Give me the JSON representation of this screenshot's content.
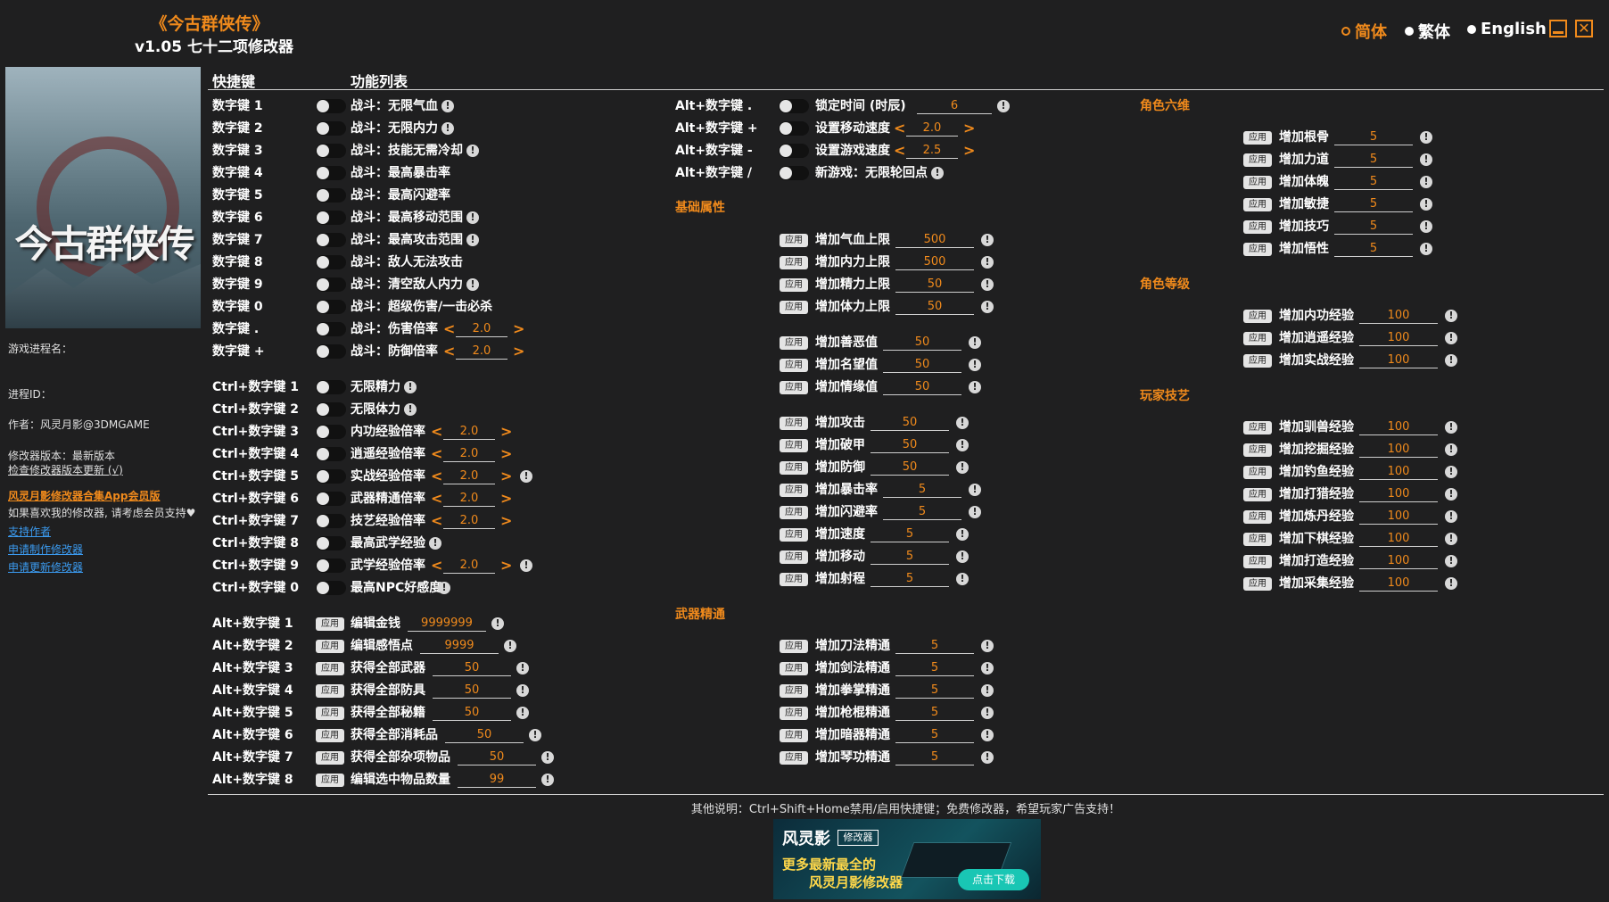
{
  "header": {
    "title": "《今古群侠传》",
    "subtitle": "v1.05 七十二项修改器"
  },
  "languages": [
    {
      "label": "简体",
      "selected": true
    },
    {
      "label": "繁体",
      "selected": false
    },
    {
      "label": "English",
      "selected": false
    }
  ],
  "window": {
    "minimize_icon": "minimize-icon",
    "close_icon": "close-icon",
    "close_glyph": "✕"
  },
  "cover": {
    "logo_text": "今古群侠传"
  },
  "sidebar": {
    "process_name_label": "游戏进程名：",
    "process_id_label": "进程ID：",
    "author": "作者：风灵月影@3DMGAME",
    "version": "修改器版本：最新版本",
    "check_update": "检查修改器版本更新 (√)",
    "app_promo": "风灵月影修改器合集App会员版",
    "support_note": "如果喜欢我的修改器, 请考虑会员支持♥",
    "links": [
      "支持作者",
      "申请制作修改器",
      "申请更新修改器"
    ]
  },
  "columns": {
    "hotkey": "快捷键",
    "features": "功能列表"
  },
  "info_glyph": "!",
  "apply_label": "应用",
  "arrows": {
    "left": "<",
    "right": ">"
  },
  "col1": {
    "group1": [
      {
        "key": "数字键 1",
        "label": "战斗：无限气血",
        "info": true
      },
      {
        "key": "数字键 2",
        "label": "战斗：无限内力",
        "info": true
      },
      {
        "key": "数字键 3",
        "label": "战斗：技能无需冷却",
        "info": true
      },
      {
        "key": "数字键 4",
        "label": "战斗：最高暴击率",
        "info": false
      },
      {
        "key": "数字键 5",
        "label": "战斗：最高闪避率",
        "info": false
      },
      {
        "key": "数字键 6",
        "label": "战斗：最高移动范围",
        "info": true
      },
      {
        "key": "数字键 7",
        "label": "战斗：最高攻击范围",
        "info": true
      },
      {
        "key": "数字键 8",
        "label": "战斗：敌人无法攻击",
        "info": false
      },
      {
        "key": "数字键 9",
        "label": "战斗：清空敌人内力",
        "info": true
      },
      {
        "key": "数字键 0",
        "label": "战斗：超级伤害/一击必杀",
        "info": false
      },
      {
        "key": "数字键 .",
        "label": "战斗：伤害倍率",
        "value": "2.0",
        "info": false
      },
      {
        "key": "数字键 +",
        "label": "战斗：防御倍率",
        "value": "2.0",
        "info": false
      }
    ],
    "group2": [
      {
        "key": "Ctrl+数字键 1",
        "label": "无限精力",
        "info": true
      },
      {
        "key": "Ctrl+数字键 2",
        "label": "无限体力",
        "info": true
      },
      {
        "key": "Ctrl+数字键 3",
        "label": "内功经验倍率",
        "value": "2.0",
        "info": false
      },
      {
        "key": "Ctrl+数字键 4",
        "label": "逍遥经验倍率",
        "value": "2.0",
        "info": false
      },
      {
        "key": "Ctrl+数字键 5",
        "label": "实战经验倍率",
        "value": "2.0",
        "info": true
      },
      {
        "key": "Ctrl+数字键 6",
        "label": "武器精通倍率",
        "value": "2.0",
        "info": false
      },
      {
        "key": "Ctrl+数字键 7",
        "label": "技艺经验倍率",
        "value": "2.0",
        "info": false
      },
      {
        "key": "Ctrl+数字键 8",
        "label": "最高武学经验",
        "info": true
      },
      {
        "key": "Ctrl+数字键 9",
        "label": "武学经验倍率",
        "value": "2.0",
        "info": true
      },
      {
        "key": "Ctrl+数字键 0",
        "label": "最高NPC好感度",
        "info": true
      }
    ],
    "group3": [
      {
        "key": "Alt+数字键 1",
        "label": "编辑金钱",
        "value": "9999999"
      },
      {
        "key": "Alt+数字键 2",
        "label": "编辑感悟点",
        "value": "9999"
      },
      {
        "key": "Alt+数字键 3",
        "label": "获得全部武器",
        "value": "50"
      },
      {
        "key": "Alt+数字键 4",
        "label": "获得全部防具",
        "value": "50"
      },
      {
        "key": "Alt+数字键 5",
        "label": "获得全部秘籍",
        "value": "50"
      },
      {
        "key": "Alt+数字键 6",
        "label": "获得全部消耗品",
        "value": "50"
      },
      {
        "key": "Alt+数字键 7",
        "label": "获得全部杂项物品",
        "value": "50"
      },
      {
        "key": "Alt+数字键 8",
        "label": "编辑选中物品数量",
        "value": "99"
      }
    ]
  },
  "col2": {
    "hotkeys": [
      {
        "key": "Alt+数字键 .",
        "label": "锁定时间 (时辰)",
        "value": "6",
        "type": "input"
      },
      {
        "key": "Alt+数字键 +",
        "label": "设置移动速度",
        "value": "2.0",
        "type": "spin"
      },
      {
        "key": "Alt+数字键 -",
        "label": "设置游戏速度",
        "value": "2.5",
        "type": "spin"
      },
      {
        "key": "Alt+数字键 /",
        "label": "新游戏：无限轮回点",
        "type": "none"
      }
    ],
    "section_basic": "基础属性",
    "basic1": [
      {
        "label": "增加气血上限",
        "value": "500"
      },
      {
        "label": "增加内力上限",
        "value": "500"
      },
      {
        "label": "增加精力上限",
        "value": "50"
      },
      {
        "label": "增加体力上限",
        "value": "50"
      }
    ],
    "basic2": [
      {
        "label": "增加善恶值",
        "value": "50"
      },
      {
        "label": "增加名望值",
        "value": "50"
      },
      {
        "label": "增加情缘值",
        "value": "50"
      }
    ],
    "basic3": [
      {
        "label": "增加攻击",
        "value": "50"
      },
      {
        "label": "增加破甲",
        "value": "50"
      },
      {
        "label": "增加防御",
        "value": "50"
      },
      {
        "label": "增加暴击率",
        "value": "5"
      },
      {
        "label": "增加闪避率",
        "value": "5"
      },
      {
        "label": "增加速度",
        "value": "5"
      },
      {
        "label": "增加移动",
        "value": "5"
      },
      {
        "label": "增加射程",
        "value": "5"
      }
    ],
    "section_weapon": "武器精通",
    "weapon": [
      {
        "label": "增加刀法精通",
        "value": "5"
      },
      {
        "label": "增加剑法精通",
        "value": "5"
      },
      {
        "label": "增加拳掌精通",
        "value": "5"
      },
      {
        "label": "增加枪棍精通",
        "value": "5"
      },
      {
        "label": "增加暗器精通",
        "value": "5"
      },
      {
        "label": "增加琴功精通",
        "value": "5"
      }
    ]
  },
  "col3": {
    "section_six": "角色六维",
    "six": [
      {
        "label": "增加根骨",
        "value": "5"
      },
      {
        "label": "增加力道",
        "value": "5"
      },
      {
        "label": "增加体魄",
        "value": "5"
      },
      {
        "label": "增加敏捷",
        "value": "5"
      },
      {
        "label": "增加技巧",
        "value": "5"
      },
      {
        "label": "增加悟性",
        "value": "5"
      }
    ],
    "section_level": "角色等级",
    "level": [
      {
        "label": "增加内功经验",
        "value": "100"
      },
      {
        "label": "增加逍遥经验",
        "value": "100"
      },
      {
        "label": "增加实战经验",
        "value": "100"
      }
    ],
    "section_skill": "玩家技艺",
    "skill": [
      {
        "label": "增加驯兽经验",
        "value": "100"
      },
      {
        "label": "增加挖掘经验",
        "value": "100"
      },
      {
        "label": "增加钓鱼经验",
        "value": "100"
      },
      {
        "label": "增加打猎经验",
        "value": "100"
      },
      {
        "label": "增加炼丹经验",
        "value": "100"
      },
      {
        "label": "增加下棋经验",
        "value": "100"
      },
      {
        "label": "增加打造经验",
        "value": "100"
      },
      {
        "label": "增加采集经验",
        "value": "100"
      }
    ]
  },
  "footer": {
    "note": "其他说明：Ctrl+Shift+Home禁用/启用快捷键；免费修改器，希望玩家广告支持！"
  },
  "banner": {
    "brand": "风灵影",
    "tag": "修改器",
    "line1": "更多最新最全的",
    "line2": "风灵月影修改器",
    "download": "点击下载"
  }
}
